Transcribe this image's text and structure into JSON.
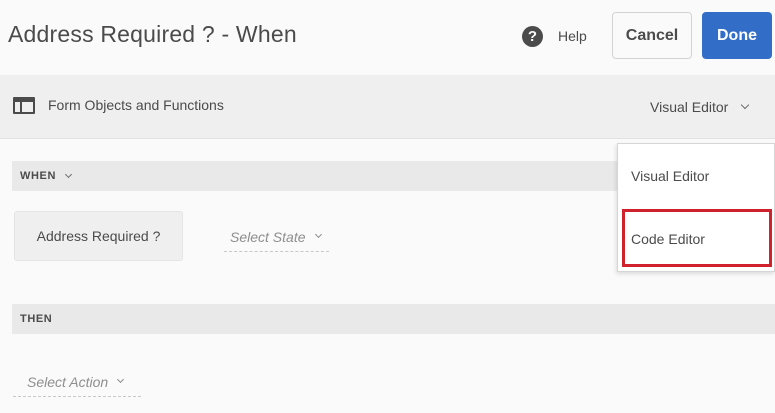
{
  "header": {
    "title": "Address Required ? - When",
    "help_glyph": "?",
    "help_label": "Help",
    "cancel_label": "Cancel",
    "done_label": "Done"
  },
  "toolbar": {
    "panel_icon": "panel-icon",
    "label": "Form Objects and Functions",
    "mode_selected": "Visual Editor"
  },
  "when_section": {
    "label": "WHEN",
    "condition_label": "Address Required ?",
    "state_placeholder": "Select State"
  },
  "then_section": {
    "label": "THEN",
    "action_placeholder": "Select Action"
  },
  "mode_menu": {
    "items": [
      {
        "label": "Visual Editor"
      },
      {
        "label": "Code Editor",
        "highlighted": true
      }
    ]
  },
  "colors": {
    "primary_button": "#326ec8",
    "highlight": "#d0222c",
    "background": "#fafafa",
    "toolbar": "#efefef"
  }
}
